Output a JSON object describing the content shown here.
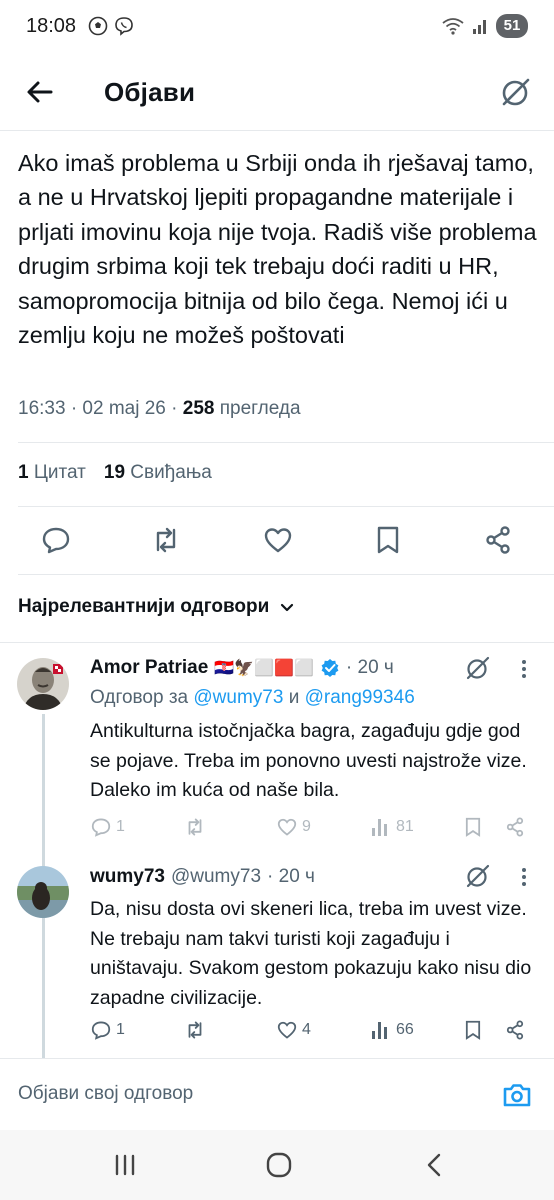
{
  "status_bar": {
    "time": "18:08",
    "battery": "51"
  },
  "header": {
    "title": "Објави"
  },
  "tweet": {
    "text": "Ako imaš problema u Srbiji onda ih rješavaj tamo, a ne u Hrvatskoj ljepiti propagandne materijale i prljati imovinu koja nije tvoja. Radiš više problema drugim srbima koji tek trebaju doći raditi u HR, samopromocija bitnija od bilo čega. Nemoj ići u zemlju koju ne možeš poštovati",
    "timestamp": "16:33 · 02 maj 26 · ",
    "views_count": "258",
    "views_label": " прегледа",
    "quotes_count": "1",
    "quotes_label": "Цитат",
    "likes_count": "19",
    "likes_label": "Свиђања"
  },
  "sort": {
    "label": "Најрелевантнији одговори"
  },
  "replies": [
    {
      "name": "Amor Patriae",
      "flags": "🇭🇷🦅⬜🟥⬜",
      "time": "· 20 ч",
      "reply_to_prefix": "Одговор за ",
      "mention1": "@wumy73",
      "reply_to_and": " и ",
      "mention2": "@rang99346",
      "text": "Antikulturna istočnjačka bagra, zagađuju gdje god se pojave. Treba im ponovno uvesti najstrože vize. Daleko im kuća od naše bila.",
      "replies": "1",
      "likes": "9",
      "views": "81"
    },
    {
      "name": "wumy73",
      "handle": "@wumy73",
      "time": "· 20 ч",
      "text": "Da, nisu dosta ovi skeneri lica, treba im uvest vize. Ne trebaju nam takvi turisti koji zagađuju i uništavaju. Svakom gestom pokazuju kako nisu dio zapadne civilizacije.",
      "replies": "1",
      "likes": "4",
      "views": "66"
    }
  ],
  "compose": {
    "placeholder": "Објави свој одговор"
  },
  "colors": {
    "accent": "#1d9bf0",
    "text": "#0f1419",
    "secondary": "#536471",
    "divider": "#e6e9ec"
  }
}
